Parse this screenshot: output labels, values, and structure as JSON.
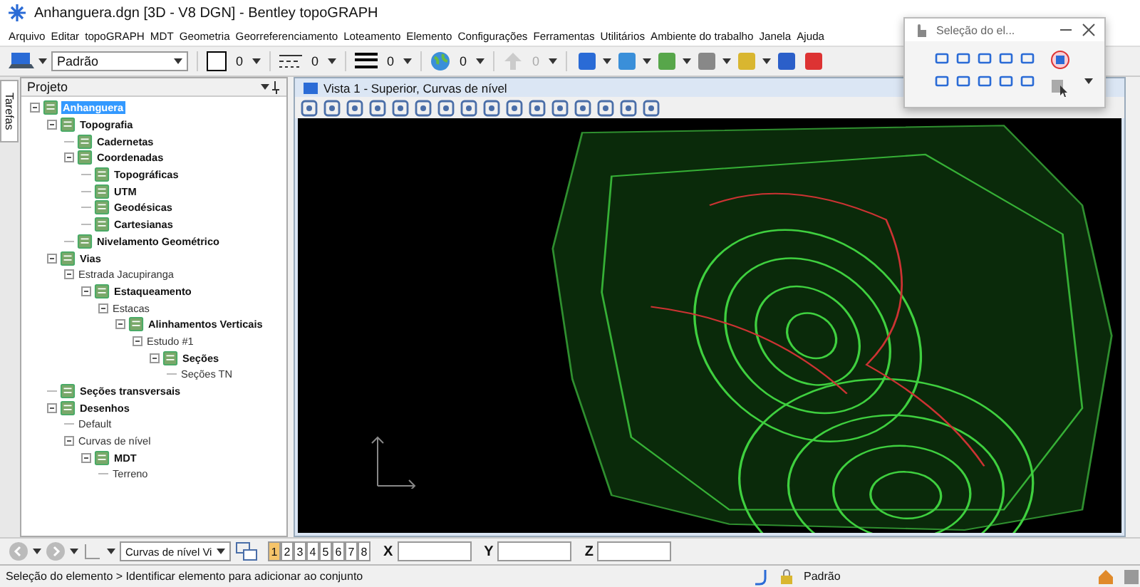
{
  "window": {
    "title": "Anhanguera.dgn [3D - V8 DGN] - Bentley topoGRAPH"
  },
  "menu": [
    "Arquivo",
    "Editar",
    "topoGRAPH",
    "MDT",
    "Geometria",
    "Georreferenciamento",
    "Loteamento",
    "Elemento",
    "Configurações",
    "Ferramentas",
    "Utilitários",
    "Ambiente do trabalho",
    "Janela",
    "Ajuda"
  ],
  "toolbar": {
    "level": "Padrão",
    "color_number": "0",
    "style": "0",
    "weight": "0",
    "transparency": "0",
    "priority": {
      "value": "0",
      "disabled": true
    }
  },
  "side_tab": "Tarefas",
  "project": {
    "title": "Projeto",
    "tree": [
      {
        "label": "Anhanguera",
        "kind": "folder",
        "selected": true,
        "children": [
          {
            "label": "Topografia",
            "kind": "folder",
            "selected": false,
            "children": [
              {
                "label": "Cadernetas",
                "kind": "folder",
                "selected": false
              },
              {
                "label": "Coordenadas",
                "kind": "folder",
                "selected": false,
                "children": [
                  {
                    "label": "Topográficas",
                    "kind": "folder",
                    "selected": false
                  },
                  {
                    "label": "UTM",
                    "kind": "folder",
                    "selected": false
                  },
                  {
                    "label": "Geodésicas",
                    "kind": "folder",
                    "selected": false
                  },
                  {
                    "label": "Cartesianas",
                    "kind": "folder",
                    "selected": false
                  }
                ]
              },
              {
                "label": "Nivelamento Geométrico",
                "kind": "folder",
                "selected": false
              }
            ]
          },
          {
            "label": "Vias",
            "kind": "folder",
            "selected": false,
            "children": [
              {
                "label": "Estrada Jacupiranga",
                "kind": "item",
                "selected": false,
                "children": [
                  {
                    "label": "Estaqueamento",
                    "kind": "folder",
                    "selected": false,
                    "children": [
                      {
                        "label": "Estacas",
                        "kind": "item",
                        "selected": false,
                        "children": [
                          {
                            "label": "Alinhamentos Verticais",
                            "kind": "folder",
                            "selected": false,
                            "children": [
                              {
                                "label": "Estudo #1",
                                "kind": "item",
                                "selected": false,
                                "children": [
                                  {
                                    "label": "Seções",
                                    "kind": "folder",
                                    "selected": false,
                                    "children": [
                                      {
                                        "label": "Seções TN",
                                        "kind": "item",
                                        "selected": false
                                      }
                                    ]
                                  }
                                ]
                              }
                            ]
                          }
                        ]
                      }
                    ]
                  }
                ]
              }
            ]
          },
          {
            "label": "Seções transversais",
            "kind": "folder",
            "selected": false
          },
          {
            "label": "Desenhos",
            "kind": "folder",
            "selected": false,
            "children": [
              {
                "label": "Default",
                "kind": "item",
                "selected": false
              },
              {
                "label": "Curvas de nível",
                "kind": "item",
                "selected": false,
                "children": [
                  {
                    "label": "MDT",
                    "kind": "folder",
                    "selected": false,
                    "children": [
                      {
                        "label": "Terreno",
                        "kind": "item",
                        "selected": false
                      }
                    ]
                  }
                ]
              }
            ]
          }
        ]
      }
    ]
  },
  "view": {
    "title": "Vista 1 - Superior, Curvas de nível"
  },
  "bottom_bar": {
    "view_combo": "Curvas de nível Vi",
    "views": [
      {
        "label": "1",
        "selected": true
      },
      {
        "label": "2",
        "selected": false
      },
      {
        "label": "3",
        "selected": false
      },
      {
        "label": "4",
        "selected": false
      },
      {
        "label": "5",
        "selected": false
      },
      {
        "label": "6",
        "selected": false
      },
      {
        "label": "7",
        "selected": false
      },
      {
        "label": "8",
        "selected": false
      }
    ],
    "coords": [
      {
        "label": "X"
      },
      {
        "label": "Y"
      },
      {
        "label": "Z"
      }
    ]
  },
  "status_bar": {
    "message": "Seleção do elemento > Identificar elemento para adicionar ao conjunto",
    "level": "Padrão"
  },
  "dialog": {
    "title": "Seleção do el..."
  }
}
